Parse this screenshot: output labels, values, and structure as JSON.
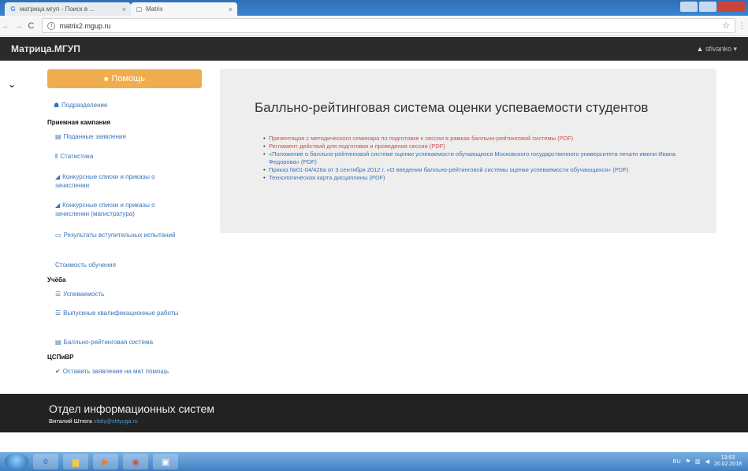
{
  "browser": {
    "tabs": [
      {
        "label": "матрица мгуп - Поиск в ...",
        "favicon": "google-icon"
      },
      {
        "label": "Matrix",
        "favicon": "page-icon"
      }
    ],
    "url": "matrix2.mgup.ru"
  },
  "site": {
    "brand": "Матрица.МГУП",
    "user": "sfivanko"
  },
  "sidebar": {
    "help_button": "Помощь",
    "items": [
      {
        "type": "link",
        "icon": "users-icon",
        "label": "Подразделение"
      },
      {
        "type": "head",
        "label": "Приемная кампания"
      },
      {
        "type": "link",
        "icon": "building-icon",
        "label": "Поданные заявления"
      },
      {
        "type": "link",
        "icon": "stats-icon",
        "label": "Статистика"
      },
      {
        "type": "link",
        "icon": "chart-icon",
        "label": "Конкурсные списки и приказы о зачислении"
      },
      {
        "type": "link",
        "icon": "chart-icon",
        "label": "Конкурсные списки и приказы о зачислении (магистратура)"
      },
      {
        "type": "link",
        "icon": "monitor-icon",
        "label": "Результаты вступительных испытаний"
      },
      {
        "type": "link",
        "icon": "",
        "label": "Стоимость обучения"
      },
      {
        "type": "head",
        "label": "Учёба"
      },
      {
        "type": "link",
        "icon": "list-icon",
        "label": "Успеваемость"
      },
      {
        "type": "link",
        "icon": "list-icon",
        "label": "Выпускные квалификационные работы"
      },
      {
        "type": "link",
        "icon": "building-icon",
        "label": "Балльно-рейтинговая система"
      },
      {
        "type": "head",
        "label": "ЦСПиВР"
      },
      {
        "type": "link",
        "icon": "check-icon",
        "label": "Оставить заявление на мат помощь"
      }
    ]
  },
  "main": {
    "title": "Балльно-рейтинговая система оценки успеваемости студентов",
    "links": [
      {
        "text": "Презентация с методического семинара по подготовке к сессии в рамках балльно-рейтинговой системы (PDF)",
        "color": "red"
      },
      {
        "text": "Регламент действий для подготовки и проведения сессии (PDF)",
        "color": "red"
      },
      {
        "text": "«Положение о балльно-рейтинговой системе оценки успеваемости обучающихся Московского государственного университета печати имени Ивана Федорова» (PDF)",
        "color": "blue"
      },
      {
        "text": "Приказ №01-04/426а от 3 сентября 2012 г. «О введении балльно-рейтинговой системы оценки успеваемости обучающихся» (PDF)",
        "color": "blue"
      },
      {
        "text": "Технологическая карта дисциплины (PDF)",
        "color": "blue"
      }
    ]
  },
  "footer": {
    "title": "Отдел информационных систем",
    "author": "Виталий Штюга",
    "email": "vitaly@shtyuga.ru"
  },
  "taskbar": {
    "lang": "RU",
    "time": "13:53",
    "date": "20.02.2018"
  },
  "colors": {
    "help_button": "#f0ad4e",
    "navbar": "#2a2a2a",
    "link_blue": "#3a74b8",
    "link_red": "#c9504a",
    "footer": "#222222"
  }
}
